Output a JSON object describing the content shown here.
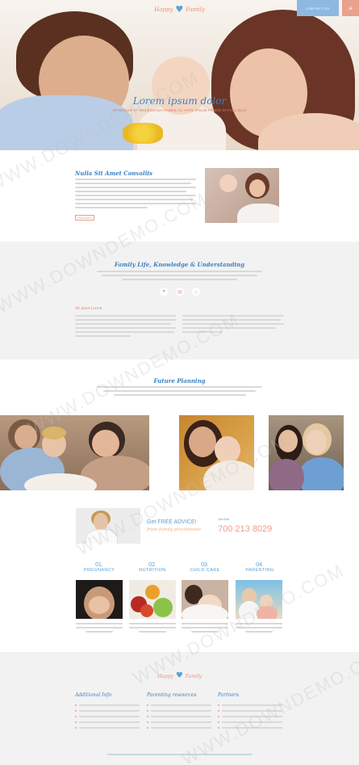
{
  "header": {
    "logo_left": "Happy",
    "logo_right": "Family",
    "contact_label": "CONTACT US",
    "menu_icon": "hamburger-icon"
  },
  "hero": {
    "title": "Lorem ipsum dolor",
    "subtitle": "INTERDUM ET MALESUADA FAMES AC ANTE IPSUM PRIMIS IN FAUCIBUS"
  },
  "intro": {
    "title": "Nulla Sit Amet Convallis",
    "more_label": "Read More"
  },
  "knowledge": {
    "title": "Family Life, Knowledge & Understanding",
    "icons": [
      "heart-icon",
      "book-icon",
      "cake-icon"
    ],
    "label": "Sit Amet Lorem"
  },
  "planning": {
    "title": "Future Planning"
  },
  "advice": {
    "title": "Get FREE ADVICE!",
    "subtitle": "from family practitioner",
    "phone_label": "Just Dial",
    "phone": "700 213 8029",
    "categories": [
      {
        "num": "01.",
        "name": "PREGNANCY"
      },
      {
        "num": "02.",
        "name": "NUTRITION"
      },
      {
        "num": "03.",
        "name": "CHILD CARE"
      },
      {
        "num": "04.",
        "name": "PARENTING"
      }
    ]
  },
  "footer": {
    "logo_left": "Happy",
    "logo_right": "Family",
    "columns": [
      {
        "title": "Additional Info"
      },
      {
        "title": "Parenting resources"
      },
      {
        "title": "Partners"
      }
    ]
  },
  "colors": {
    "accent_blue": "#3b82c4",
    "accent_coral": "#e9a08d",
    "light_bg": "#f2f2f2"
  },
  "watermark": "WWW.DOWNDEMO.COM"
}
